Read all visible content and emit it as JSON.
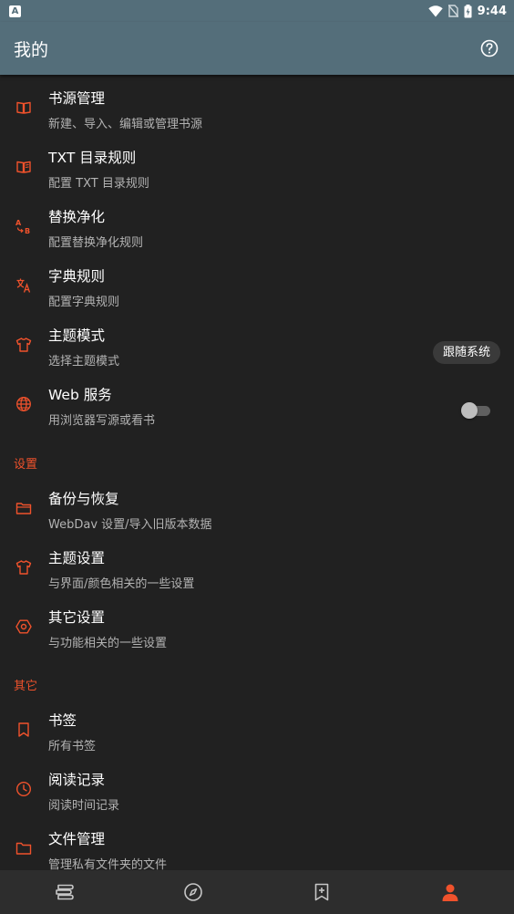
{
  "status_bar": {
    "left_icon": "A",
    "time": "9:44"
  },
  "app_bar": {
    "title": "我的",
    "help_icon": "help-circle-icon"
  },
  "items_main": [
    {
      "title": "书源管理",
      "subtitle": "新建、导入、编辑或管理书源",
      "icon": "book-open-icon"
    },
    {
      "title": "TXT 目录规则",
      "subtitle": "配置 TXT 目录规则",
      "icon": "book-open-icon"
    },
    {
      "title": "替换净化",
      "subtitle": "配置替换净化规则",
      "icon": "replace-ab-icon"
    },
    {
      "title": "字典规则",
      "subtitle": "配置字典规则",
      "icon": "translate-icon"
    },
    {
      "title": "主题模式",
      "subtitle": "选择主题模式",
      "icon": "tshirt-icon",
      "value": "跟随系统"
    },
    {
      "title": "Web 服务",
      "subtitle": "用浏览器写源或看书",
      "icon": "globe-icon",
      "toggle": false
    }
  ],
  "section_settings": {
    "header": "设置",
    "items": [
      {
        "title": "备份与恢复",
        "subtitle": "WebDav 设置/导入旧版本数据",
        "icon": "folder-open-icon"
      },
      {
        "title": "主题设置",
        "subtitle": "与界面/颜色相关的一些设置",
        "icon": "tshirt-icon"
      },
      {
        "title": "其它设置",
        "subtitle": "与功能相关的一些设置",
        "icon": "hexagon-settings-icon"
      }
    ]
  },
  "section_other": {
    "header": "其它",
    "items": [
      {
        "title": "书签",
        "subtitle": "所有书签",
        "icon": "bookmark-icon"
      },
      {
        "title": "阅读记录",
        "subtitle": "阅读时间记录",
        "icon": "clock-icon"
      },
      {
        "title": "文件管理",
        "subtitle": "管理私有文件夹的文件",
        "icon": "folder-icon"
      }
    ]
  },
  "bottom_nav": [
    {
      "name": "bookshelf",
      "icon": "bookshelf-icon",
      "active": false
    },
    {
      "name": "explore",
      "icon": "compass-icon",
      "active": false
    },
    {
      "name": "rss",
      "icon": "bookmark-add-icon",
      "active": false
    },
    {
      "name": "my",
      "icon": "person-icon",
      "active": true
    }
  ],
  "colors": {
    "accent": "#f0522c",
    "app_bar": "#546e7a",
    "background": "#212121",
    "bottom_nav": "#2d2d2d"
  }
}
